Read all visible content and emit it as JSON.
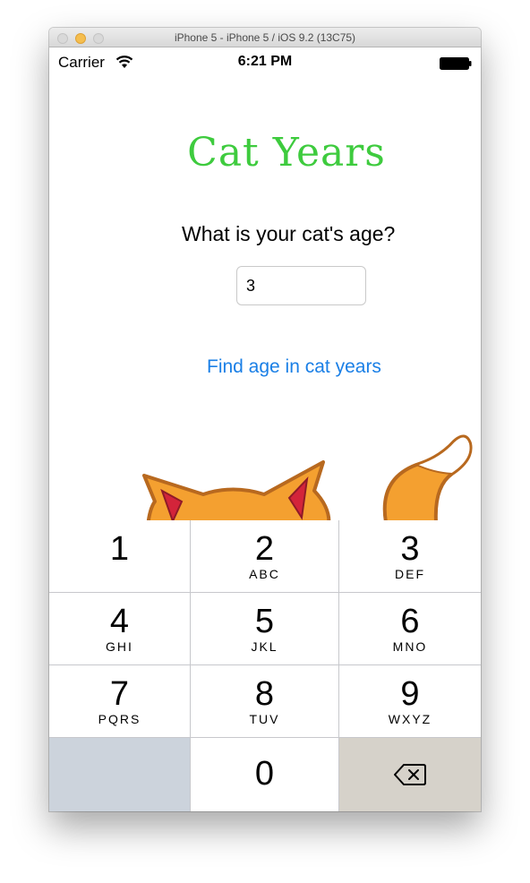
{
  "window": {
    "title": "iPhone 5 - iPhone 5 / iOS 9.2 (13C75)"
  },
  "status_bar": {
    "carrier": "Carrier",
    "time": "6:21 PM"
  },
  "app": {
    "title": "Cat Years",
    "question": "What is your cat's age?",
    "age_value": "3",
    "find_button_label": "Find age in cat years",
    "colors": {
      "title": "#3ecb3e",
      "button": "#1a7fe6",
      "cat_fur": "#f4a030",
      "cat_outline": "#b8691f",
      "cat_inner_ear": "#d3243a"
    }
  },
  "keypad": {
    "keys": [
      {
        "digit": "1",
        "letters": ""
      },
      {
        "digit": "2",
        "letters": "ABC"
      },
      {
        "digit": "3",
        "letters": "DEF"
      },
      {
        "digit": "4",
        "letters": "GHI"
      },
      {
        "digit": "5",
        "letters": "JKL"
      },
      {
        "digit": "6",
        "letters": "MNO"
      },
      {
        "digit": "7",
        "letters": "PQRS"
      },
      {
        "digit": "8",
        "letters": "TUV"
      },
      {
        "digit": "9",
        "letters": "WXYZ"
      },
      {
        "digit": "0",
        "letters": ""
      }
    ],
    "delete_icon": "backspace-icon"
  }
}
